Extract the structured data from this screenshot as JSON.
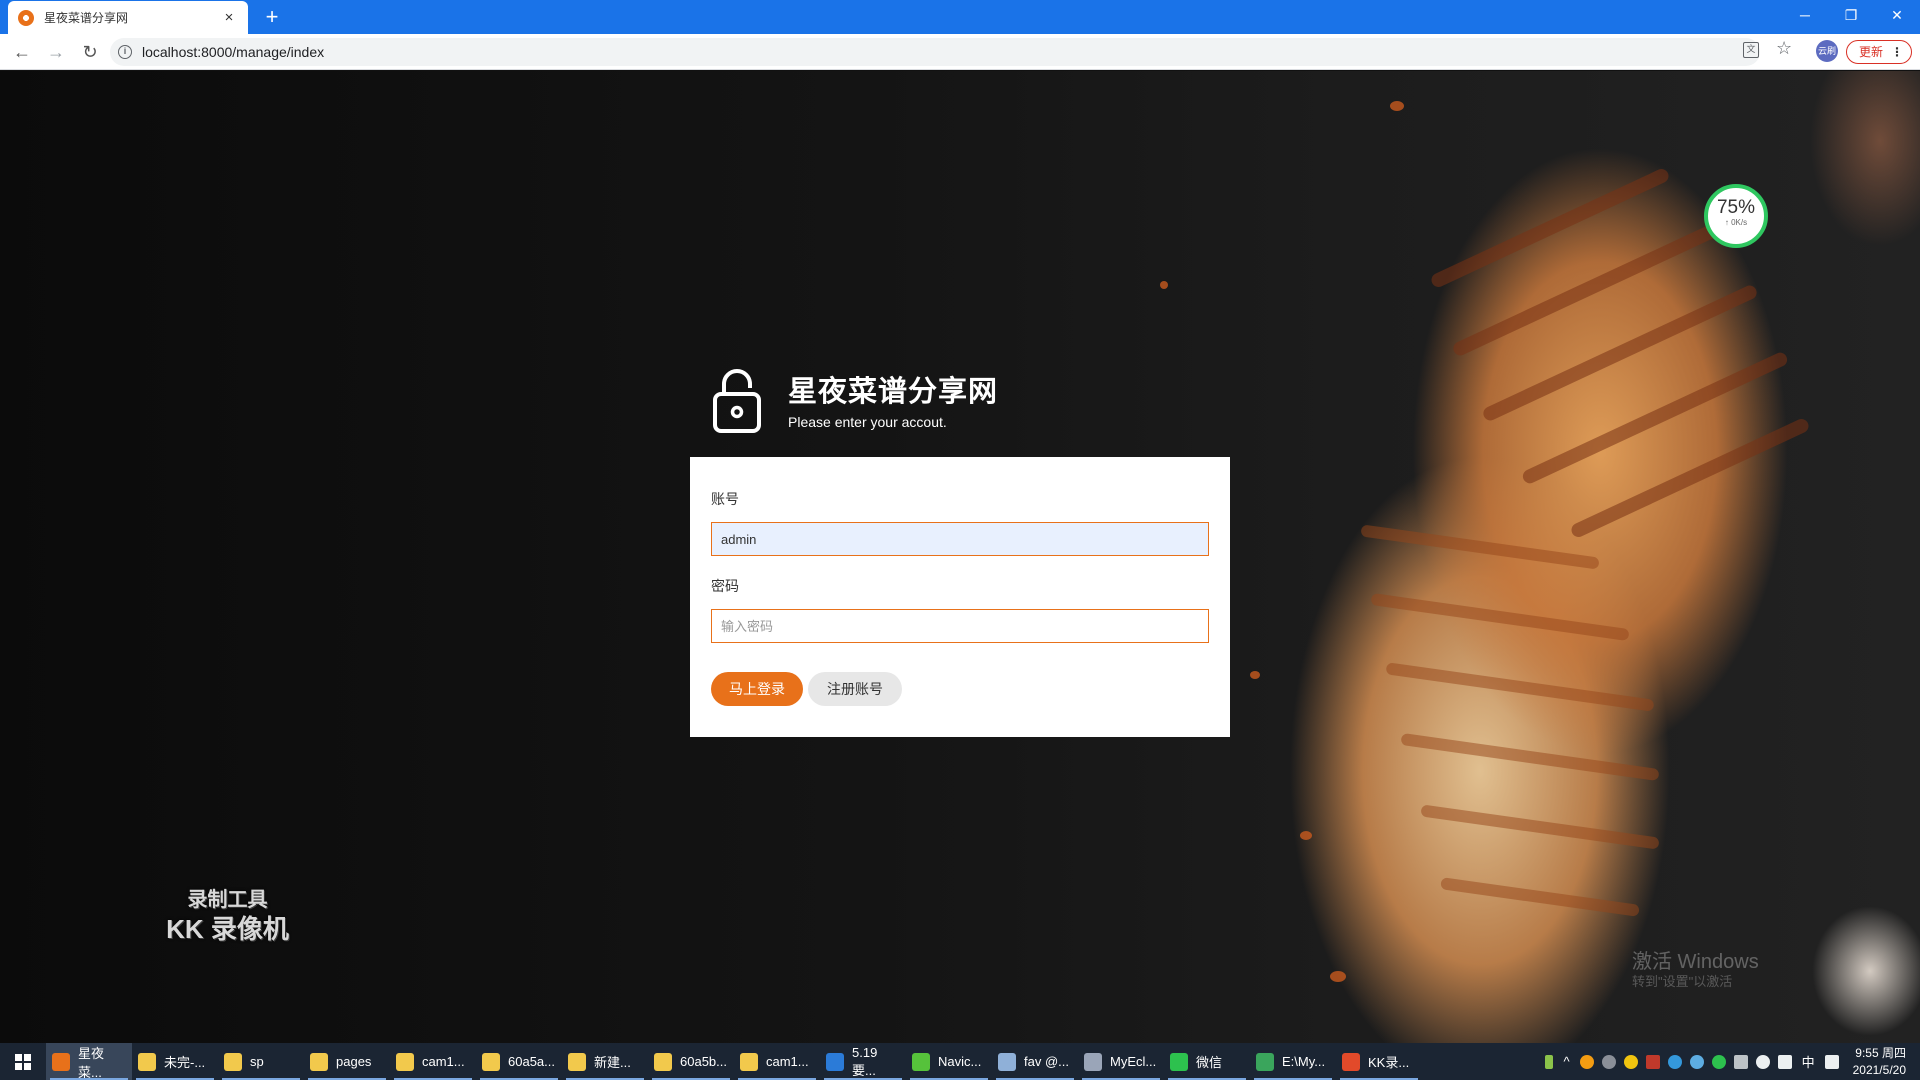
{
  "browser": {
    "tab_title": "星夜菜谱分享网",
    "tab_close": "×",
    "new_tab": "+",
    "url": "localhost:8000/manage/index",
    "update_label": "更新",
    "profile_label": "云刷",
    "window_controls": {
      "minimize": "─",
      "restore": "❐",
      "close": "✕"
    },
    "nav": {
      "back": "←",
      "forward": "→",
      "reload": "↻"
    }
  },
  "login": {
    "site_title": "星夜菜谱分享网",
    "subtitle": "Please enter your accout.",
    "account_label": "账号",
    "account_value": "admin",
    "password_label": "密码",
    "password_placeholder": "输入密码",
    "login_button": "马上登录",
    "register_button": "注册账号",
    "accent_color": "#e8711a"
  },
  "overlay": {
    "speed_percent": "75%",
    "speed_rate": "↑ 0K/s",
    "recorder_line1": "录制工具",
    "recorder_line2": "KK 录像机",
    "activate_title": "激活 Windows",
    "activate_sub": "转到\"设置\"以激活"
  },
  "taskbar": {
    "items": [
      {
        "label": "星夜菜...",
        "icon": "chrome-icon",
        "color": "#e8711a"
      },
      {
        "label": "未完-...",
        "icon": "folder-icon",
        "color": "#f2c94c"
      },
      {
        "label": "sp",
        "icon": "folder-icon",
        "color": "#f2c94c"
      },
      {
        "label": "pages",
        "icon": "folder-icon",
        "color": "#f2c94c"
      },
      {
        "label": "cam1...",
        "icon": "folder-icon",
        "color": "#f2c94c"
      },
      {
        "label": "60a5a...",
        "icon": "folder-icon",
        "color": "#f2c94c"
      },
      {
        "label": "新建...",
        "icon": "folder-icon",
        "color": "#f2c94c"
      },
      {
        "label": "60a5b...",
        "icon": "folder-icon",
        "color": "#f2c94c"
      },
      {
        "label": "cam1...",
        "icon": "folder-icon",
        "color": "#f2c94c"
      },
      {
        "label": "5.19要...",
        "icon": "vscode-icon",
        "color": "#2b7bd8"
      },
      {
        "label": "Navic...",
        "icon": "navicat-icon",
        "color": "#56c23b"
      },
      {
        "label": "fav @...",
        "icon": "database-icon",
        "color": "#8fb0d8"
      },
      {
        "label": "MyEcl...",
        "icon": "eclipse-icon",
        "color": "#9aa5b8"
      },
      {
        "label": "微信",
        "icon": "wechat-icon",
        "color": "#2dc14e"
      },
      {
        "label": "E:\\My...",
        "icon": "editor-icon",
        "color": "#3aa55c"
      },
      {
        "label": "KK录...",
        "icon": "kk-recorder-icon",
        "color": "#e24a2a"
      }
    ],
    "ime": "中",
    "time": "9:55 周四",
    "date": "2021/5/20"
  }
}
